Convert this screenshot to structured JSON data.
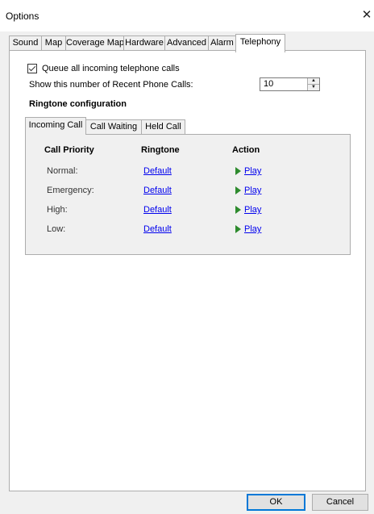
{
  "window": {
    "title": "Options",
    "close_glyph": "✕"
  },
  "tabs": [
    {
      "label": "Sound"
    },
    {
      "label": "Map"
    },
    {
      "label": "Coverage Map"
    },
    {
      "label": "Hardware"
    },
    {
      "label": "Advanced"
    },
    {
      "label": "Alarm"
    },
    {
      "label": "Telephony",
      "active": true
    }
  ],
  "telephony": {
    "queue_label": "Queue all incoming telephone calls",
    "queue_checked": true,
    "recent_calls_label": "Show this number of Recent Phone Calls:",
    "recent_calls_value": "10",
    "ringtone_header": "Ringtone configuration"
  },
  "inner_tabs": [
    {
      "label": "Incoming Call",
      "active": true
    },
    {
      "label": "Call Waiting"
    },
    {
      "label": "Held Call"
    }
  ],
  "ringtone_table": {
    "headers": {
      "priority": "Call Priority",
      "ringtone": "Ringtone",
      "action": "Action"
    },
    "rows": [
      {
        "priority": "Normal:",
        "ringtone": "Default",
        "action": "Play"
      },
      {
        "priority": "Emergency:",
        "ringtone": "Default",
        "action": "Play"
      },
      {
        "priority": "High:",
        "ringtone": "Default",
        "action": "Play"
      },
      {
        "priority": "Low:",
        "ringtone": "Default",
        "action": "Play"
      }
    ]
  },
  "buttons": {
    "ok": "OK",
    "cancel": "Cancel"
  },
  "icons": {
    "close": "close-icon",
    "play": "play-icon",
    "spin": "spin-updown-icon",
    "check": "checkmark-icon"
  },
  "colors": {
    "link": "#0000ee",
    "play_arrow": "#2e8b2e",
    "default_button_border": "#0078d7"
  }
}
